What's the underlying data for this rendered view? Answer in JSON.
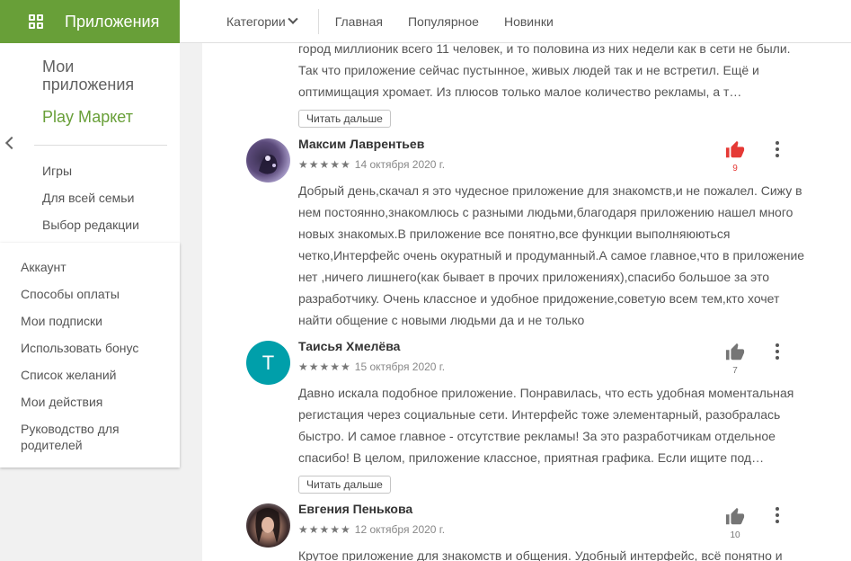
{
  "header": {
    "app_title": "Приложения",
    "categories_label": "Категории",
    "nav": [
      "Главная",
      "Популярное",
      "Новинки"
    ]
  },
  "sidebar": {
    "my_apps": "Мои приложения",
    "store": "Play Маркет",
    "sub_items": [
      "Игры",
      "Для всей семьи",
      "Выбор редакции"
    ],
    "account_items": [
      "Аккаунт",
      "Способы оплаты",
      "Мои подписки",
      "Использовать бонус",
      "Список желаний",
      "Мои действия",
      "Руководство для родителей"
    ]
  },
  "colors": {
    "brand": "#689f38",
    "like_active": "#e53935",
    "avatar_teal": "#009faa"
  },
  "reviews": [
    {
      "text": "город миллионик всего 11 человек, и то половина из них недели как в сети не были. Так что приложение сейчас пустынное, живых людей так и не встретил. Ещё и оптимищация хромает. Из плюсов только малое количество рекламы, а т…",
      "read_more": "Читать дальше"
    },
    {
      "author": "Максим Лаврентьев",
      "stars": "★★★★★",
      "date": "14 октября 2020 г.",
      "likes": "9",
      "liked": true,
      "text": "Добрый день,скачал я это чудесное приложение для знакомств,и не пожалел. Сижу в нем постоянно,знакомлюсь с разными людьми,благодаря приложению нашел много новых знакомых.В приложение все понятно,все функции выполняюються четко,Интерфейс очень окуратный и продуманный.А самое главное,что в приложение нет ,ничего лишнего(как бывает в прочих приложениях),спасибо большое за это разработчику. Очень классное и удобное придожение,советую всем тем,кто хочет найти общение с новыми людьми да и не только"
    },
    {
      "author": "Таисья Хмелёва",
      "initial": "T",
      "stars": "★★★★★",
      "date": "15 октября 2020 г.",
      "likes": "7",
      "text": "Давно искала подобное приложение. Понравилась, что есть удобная моментальная регистация через социальные сети. Интерфейс тоже элементарный, разобралась быстро. И самое главное - отсутствие рекламы! За это разработчикам отдельное спасибо! В целом, приложение классное, приятная графика. Если ищите под…",
      "read_more": "Читать дальше"
    },
    {
      "author": "Евгения Пенькова",
      "stars": "★★★★★",
      "date": "12 октября 2020 г.",
      "likes": "10",
      "text": "Крутое приложение для знакомств и общения. Удобный интерфейс, всё понятно и"
    }
  ]
}
